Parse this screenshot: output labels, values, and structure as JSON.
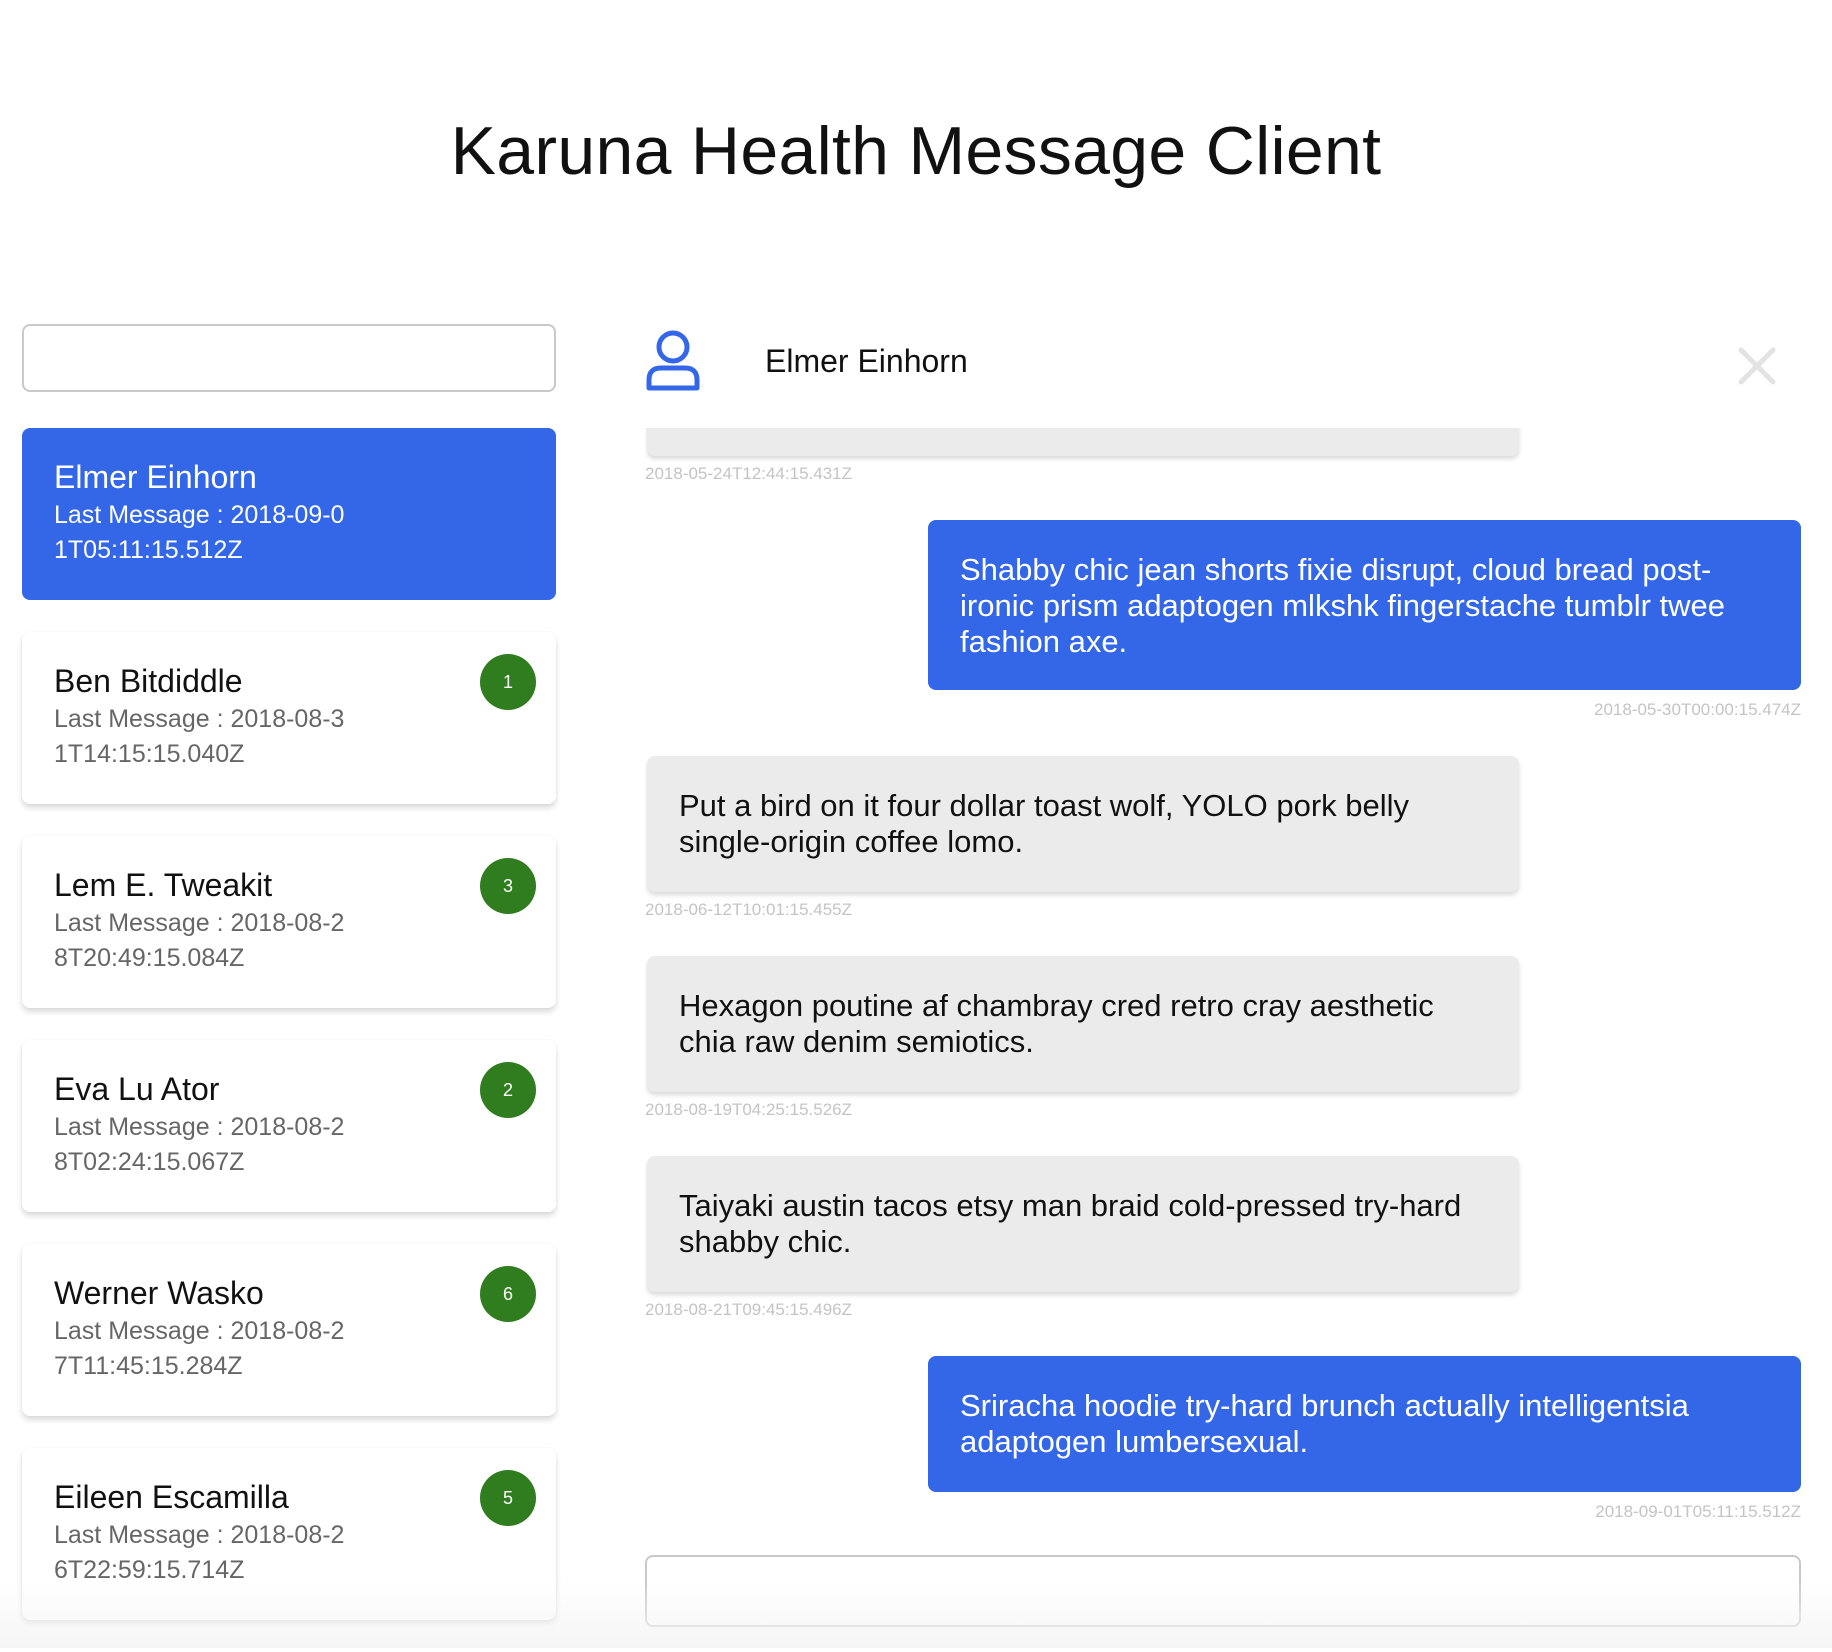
{
  "app": {
    "title": "Karuna Health Message Client"
  },
  "search": {
    "placeholder": "",
    "value": ""
  },
  "conversations": [
    {
      "name": "Elmer Einhorn",
      "last_label": "Last Message : ",
      "last_time": "2018-09-01T05:11:15.512Z",
      "unread": "",
      "active": true
    },
    {
      "name": "Ben Bitdiddle",
      "last_label": "Last Message : ",
      "last_time": "2018-08-31T14:15:15.040Z",
      "unread": "1",
      "active": false
    },
    {
      "name": "Lem E. Tweakit",
      "last_label": "Last Message : ",
      "last_time": "2018-08-28T20:49:15.084Z",
      "unread": "3",
      "active": false
    },
    {
      "name": "Eva Lu Ator",
      "last_label": "Last Message : ",
      "last_time": "2018-08-28T02:24:15.067Z",
      "unread": "2",
      "active": false
    },
    {
      "name": "Werner Wasko",
      "last_label": "Last Message : ",
      "last_time": "2018-08-27T11:45:15.284Z",
      "unread": "6",
      "active": false
    },
    {
      "name": "Eileen Escamilla",
      "last_label": "Last Message : ",
      "last_time": "2018-08-26T22:59:15.714Z",
      "unread": "5",
      "active": false
    }
  ],
  "chat": {
    "contact_name": "Elmer Einhorn",
    "avatar_icon": "user-icon",
    "close_icon": "close-icon",
    "messages": [
      {
        "direction": "in",
        "text": "",
        "timestamp": "2018-05-24T12:44:15.431Z"
      },
      {
        "direction": "out",
        "text": "Shabby chic jean shorts fixie disrupt, cloud bread post-ironic prism adaptogen mlkshk fingerstache tumblr twee fashion axe.",
        "timestamp": "2018-05-30T00:00:15.474Z"
      },
      {
        "direction": "in",
        "text": "Put a bird on it four dollar toast wolf, YOLO pork belly single-origin coffee lomo.",
        "timestamp": "2018-06-12T10:01:15.455Z"
      },
      {
        "direction": "in",
        "text": "Hexagon poutine af chambray cred retro cray aesthetic chia raw denim semiotics.",
        "timestamp": "2018-08-19T04:25:15.526Z"
      },
      {
        "direction": "in",
        "text": "Taiyaki austin tacos etsy man braid cold-pressed try-hard shabby chic.",
        "timestamp": "2018-08-21T09:45:15.496Z"
      },
      {
        "direction": "out",
        "text": "Sriracha hoodie try-hard brunch actually intelligentsia adaptogen lumbersexual.",
        "timestamp": "2018-09-01T05:11:15.512Z"
      }
    ]
  },
  "compose": {
    "placeholder": "",
    "value": ""
  },
  "colors": {
    "accent": "#3467e8",
    "badge": "#2f7d1e",
    "incoming_bubble": "#ebebeb"
  }
}
